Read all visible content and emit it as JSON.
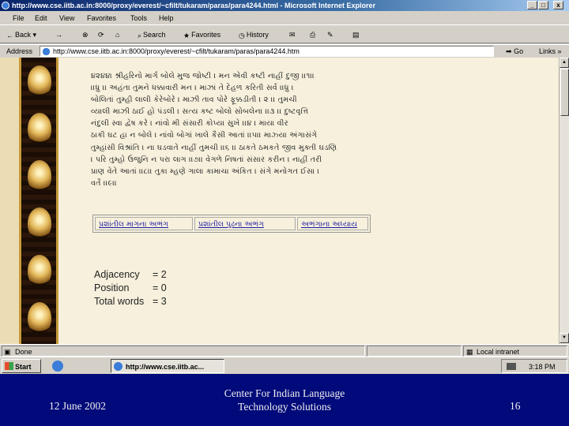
{
  "window": {
    "title": "http://www.cse.iitb.ac.in:8000/proxy/everest/~cfilt/tukaram/paras/para4244.html - Microsoft Internet Explorer",
    "min_label": "_",
    "max_label": "□",
    "close_label": "x"
  },
  "menu": [
    "File",
    "Edit",
    "View",
    "Favorites",
    "Tools",
    "Help"
  ],
  "toolbar": {
    "back_label": "Back",
    "forward_label": "→",
    "stop_label": "⊗",
    "refresh_label": "⟳",
    "home_label": "⌂",
    "search_label": "Search",
    "favorites_label": "Favorites",
    "history_label": "History",
    "mail_label": "✉",
    "print_label": "⎙",
    "edit_label": "✎",
    "discuss_label": "▤"
  },
  "address": {
    "label": "Address",
    "url": "http://www.cse.iitb.ac.in:8000/proxy/everest/~cfilt/tukaram/paras/para4244.htm",
    "go_label": "Go",
    "links_label": "Links »"
  },
  "page": {
    "poem_lines": [
      "૪૨૪૪। શ્રીહરિનો માર્ગ બોલે મુજ જોષ્ટી । મન એવી કષ્ટી નાહીં દુજી ।।૧।।",
      "।।ધ્રુ ।। અહંતા તુમને ધક્કાવારી મન । માઝાં તે દેહળ કરિતી સર્વ ।।ધ્રુ ।",
      "બોલિતાં તુમ્હી લાલી કેરેબોરે । માઝી તાવ પોરે ફૂક્કડીતી । ૨ ।। તુમચી",
      "વ્યાલી માઝી ઠાઈ હો પંડલી । સત્ય કષ્ટ બોલો સોબલેના ।।૩ ।। દુષ્ટવૃત્તિ",
      "નંદુલી સ્વા દ્વેષ કરે । નાંવો મી સંસારી કોપ્યા સુખે ।।૪ । માયા વીર",
      "ઠાકી ઘટ હા ન બોલે । નાંવો બોગાં ખાલે કૈસી આતાં ।।૫।। માઝ્યા અંગાસંગે",
      "તુમ્હાંસી વિશ્રાંતિ । ના ઘડવાતે નાહીં તુમચી ।।૬ ।। ઠાકતે ઠમકતે જીવ મુક્તી ઘડણિ",
      "। પરિ તુમ્હો ઉજુનિ ન પરા લાગ ।।૭।। વેગળે નિષતાં સંસાર કરીન । નાહીં તરી",
      "પ્રાણ વેતે આતાં ।।૮।। તુકા મ્હણે ગાલા કામાચા અંકિત । સંગે મનોગત ઈસા ।",
      "વર્તે ।।૯।।"
    ],
    "nav_links": [
      "પ્રશાંતીલ માગના અભંગ",
      "પ્રશાંતીલ પુઢના અભંગ",
      "અભંગાના અધ્યાય"
    ],
    "stats": [
      {
        "key": "Adjacency",
        "value": "= 2"
      },
      {
        "key": "Position",
        "value": "= 0"
      },
      {
        "key": "Total words",
        "value": "= 3"
      }
    ]
  },
  "status": {
    "text": "Done",
    "zone": "Local intranet"
  },
  "taskbar": {
    "start_label": "Start",
    "task_label": "http://www.cse.iitb.ac...",
    "clock": "3:18 PM"
  },
  "footer": {
    "date": "12 June 2002",
    "center_line1": "Center For Indian Language",
    "center_line2": "Technology Solutions",
    "slide_number": "16"
  }
}
